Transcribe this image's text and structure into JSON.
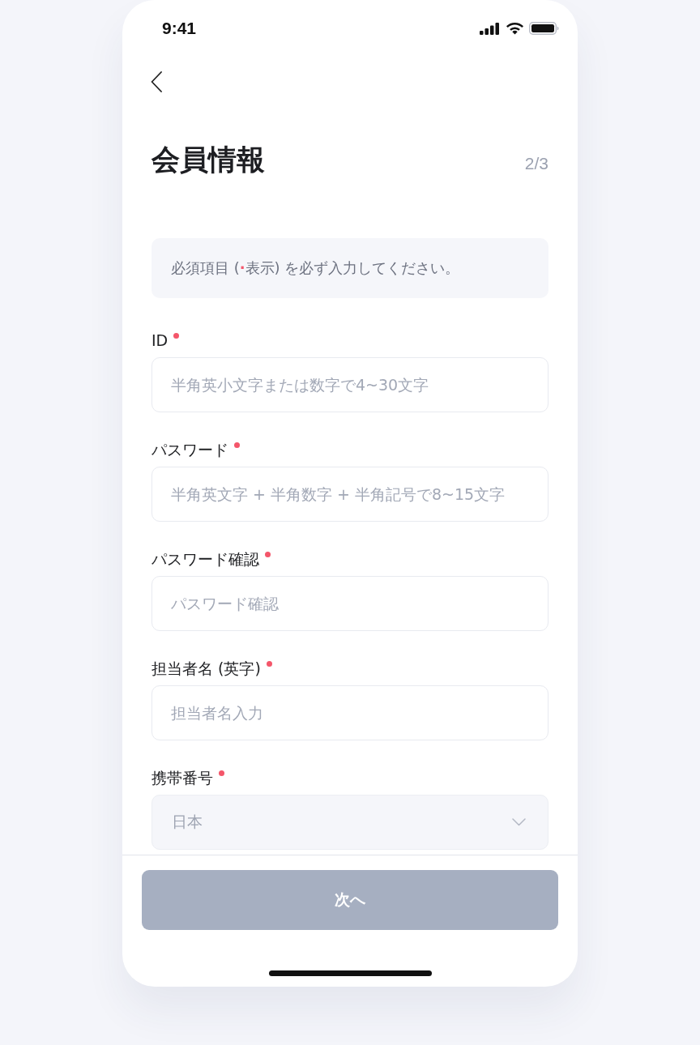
{
  "status_bar": {
    "time": "9:41"
  },
  "header": {
    "title": "会員情報",
    "step": "2/3"
  },
  "notice": {
    "segments": [
      {
        "text": "必須項目 ("
      },
      {
        "text": "·",
        "color": "#f4566a"
      },
      {
        "text": "表示) を必ず入力してください。"
      }
    ]
  },
  "fields": [
    {
      "kind": "text",
      "label": "ID",
      "required": true,
      "placeholder": "半角英小文字または数字で4~30文字"
    },
    {
      "kind": "text",
      "label": "パスワード",
      "required": true,
      "placeholder": "半角英文字 + 半角数字 + 半角記号で8~15文字"
    },
    {
      "kind": "text",
      "label": "パスワード確認",
      "required": true,
      "placeholder": "パスワード確認"
    },
    {
      "kind": "text",
      "label": "担当者名 (英字)",
      "required": true,
      "placeholder": "担当者名入力"
    },
    {
      "kind": "select",
      "label": "携帯番号",
      "required": true,
      "value": "日本",
      "disabled": true
    }
  ],
  "next_button": {
    "label": "次へ",
    "disabled": true
  }
}
